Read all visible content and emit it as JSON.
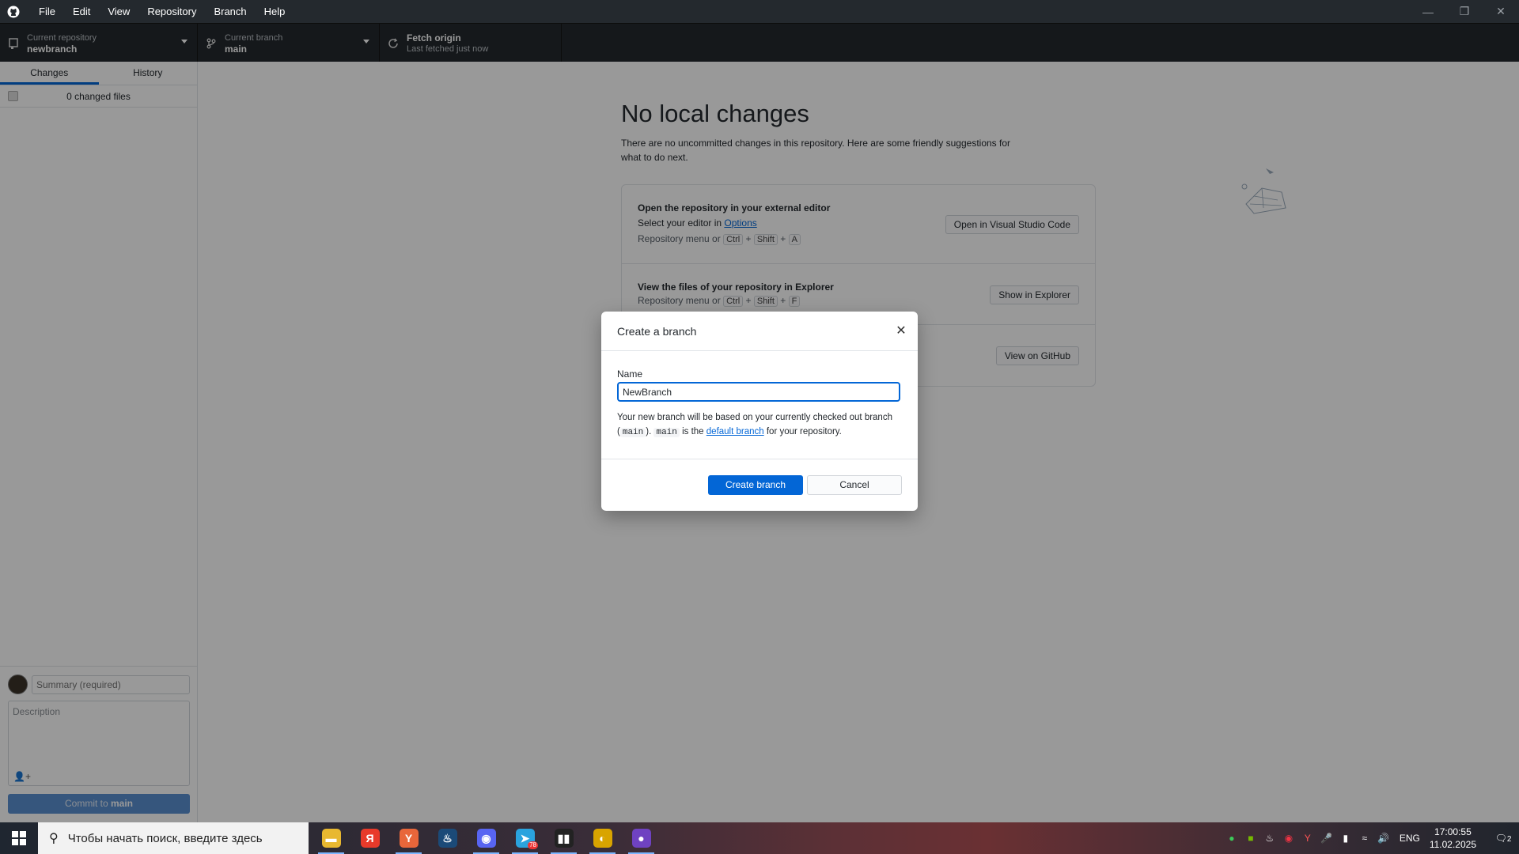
{
  "menu": [
    "File",
    "Edit",
    "View",
    "Repository",
    "Branch",
    "Help"
  ],
  "toolbar": {
    "repo_top": "Current repository",
    "repo_name": "newbranch",
    "branch_top": "Current branch",
    "branch_name": "main",
    "fetch_top": "Fetch origin",
    "fetch_bottom": "Last fetched just now"
  },
  "sidebar": {
    "tab_changes": "Changes",
    "tab_history": "History",
    "changed_files": "0 changed files",
    "summary_placeholder": "Summary (required)",
    "description_placeholder": "Description",
    "commit_prefix": "Commit to ",
    "commit_branch": "main"
  },
  "main": {
    "title": "No local changes",
    "subtitle": "There are no uncommitted changes in this repository. Here are some friendly suggestions for what to do next.",
    "card1": {
      "title": "Open the repository in your external editor",
      "line_prefix": "Select your editor in ",
      "line_link": "Options",
      "hint_prefix": "Repository menu or",
      "keys": [
        "Ctrl",
        "Shift",
        "A"
      ],
      "button": "Open in Visual Studio Code"
    },
    "card2": {
      "title": "View the files of your repository in Explorer",
      "hint_prefix": "Repository menu or",
      "keys": [
        "Ctrl",
        "Shift",
        "F"
      ],
      "button": "Show in Explorer"
    },
    "card3": {
      "button": "View on GitHub"
    }
  },
  "dialog": {
    "title": "Create a branch",
    "name_label": "Name",
    "name_value": "NewBranch",
    "help_1": "Your new branch will be based on your currently checked out branch (",
    "help_code1": "main",
    "help_2": "). ",
    "help_code2": "main",
    "help_3": " is the ",
    "help_link": "default branch",
    "help_4": " for your repository.",
    "primary_button": "Create branch",
    "cancel_button": "Cancel"
  },
  "taskbar": {
    "search_placeholder": "Чтобы начать поиск, введите здесь",
    "language": "ENG",
    "time": "17:00:55",
    "date": "11.02.2025",
    "notifications": "2",
    "telegram_badge": "78",
    "apps": [
      {
        "name": "explorer-app",
        "color": "#e8b830",
        "glyph": "▬"
      },
      {
        "name": "yandex-app",
        "color": "#e83a2a",
        "glyph": "Я"
      },
      {
        "name": "yandex-browser-app",
        "color": "#e8663a",
        "glyph": "Y"
      },
      {
        "name": "steam-app",
        "color": "#1b4a78",
        "glyph": "♨"
      },
      {
        "name": "discord-app",
        "color": "#5865f2",
        "glyph": "◉"
      },
      {
        "name": "telegram-app",
        "color": "#2aa3de",
        "glyph": "➤"
      },
      {
        "name": "mts-app",
        "color": "#222",
        "glyph": "▮▮"
      },
      {
        "name": "app-yellow",
        "color": "#d9a400",
        "glyph": "◐"
      },
      {
        "name": "github-desktop-app",
        "color": "#6f42c1",
        "glyph": "●"
      }
    ]
  }
}
